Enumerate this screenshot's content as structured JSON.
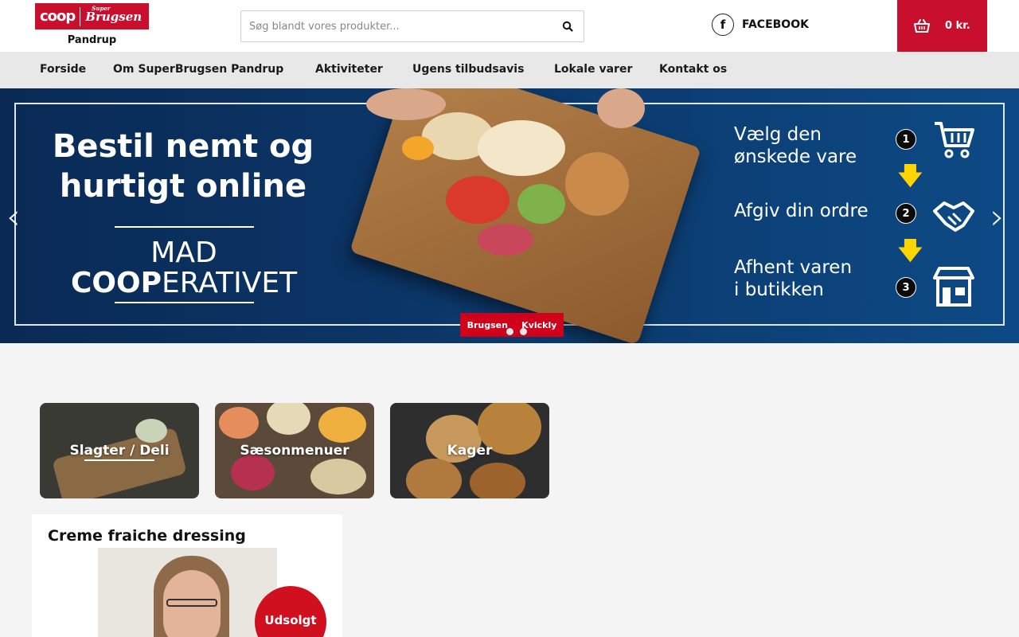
{
  "header": {
    "logo_coop": "coop",
    "logo_super": "Super",
    "logo_brugsen": "Brugsen",
    "store_name": "Pandrup",
    "search_placeholder": "Søg blandt vores produkter...",
    "facebook_label": "FACEBOOK",
    "cart_total": "0 kr."
  },
  "nav": {
    "items": [
      "Forside",
      "Om SuperBrugsen Pandrup",
      "Aktiviteter",
      "Ugens tilbudsavis",
      "Lokale varer",
      "Kontakt os"
    ]
  },
  "hero": {
    "title_line1": "Bestil nemt og",
    "title_line2": "hurtigt online",
    "mad": "MAD",
    "coop_bold": "COOP",
    "coop_rest": "ERATIVET",
    "step1_line1": "Vælg den",
    "step1_line2": "ønskede vare",
    "step2": "Afgiv din ordre",
    "step3_line1": "Afhent varen",
    "step3_line2": "i butikken",
    "step_numbers": [
      "1",
      "2",
      "3"
    ],
    "brand_left": "Brugsen",
    "brand_right": "Kvickly"
  },
  "categories": [
    "Slagter / Deli",
    "Sæsonmenuer",
    "Kager"
  ],
  "product": {
    "title": "Creme fraiche dressing",
    "badge": "Udsolgt"
  },
  "colors": {
    "brand_red": "#c8102e",
    "hero_navy": "#0c3a6e",
    "arrow_yellow": "#ffd500"
  }
}
